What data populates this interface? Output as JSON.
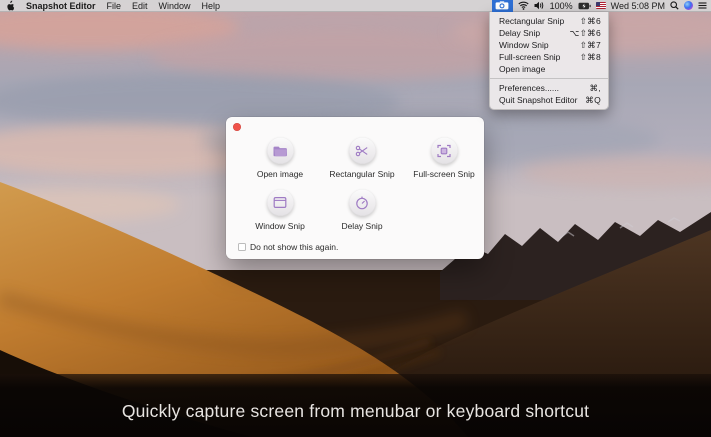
{
  "menubar": {
    "app_title": "Snapshot Editor",
    "menus": [
      {
        "label": "File"
      },
      {
        "label": "Edit"
      },
      {
        "label": "Window"
      },
      {
        "label": "Help"
      }
    ],
    "status": {
      "battery_percent": "100%",
      "clock": "Wed 5:08 PM"
    },
    "status_icons": [
      "apple-logo",
      "camera-icon",
      "wifi-icon",
      "volume-icon",
      "battery-icon",
      "us-flag-icon",
      "spotlight-search-icon",
      "siri-icon",
      "notification-center-icon"
    ]
  },
  "dropdown": {
    "primary": [
      {
        "label": "Rectangular Snip",
        "shortcut": "⇧⌘6"
      },
      {
        "label": "Delay Snip",
        "shortcut": "⌥⇧⌘6"
      },
      {
        "label": "Window Snip",
        "shortcut": "⇧⌘7"
      },
      {
        "label": "Full-screen Snip",
        "shortcut": "⇧⌘8"
      },
      {
        "label": "Open image",
        "shortcut": ""
      }
    ],
    "secondary": [
      {
        "label": "Preferences......",
        "shortcut": "⌘,"
      },
      {
        "label": "Quit Snapshot Editor",
        "shortcut": "⌘Q"
      }
    ]
  },
  "dialog": {
    "actions": [
      {
        "label": "Open image",
        "icon": "folder-icon"
      },
      {
        "label": "Rectangular Snip",
        "icon": "scissors-icon"
      },
      {
        "label": "Full-screen Snip",
        "icon": "fullscreen-icon"
      },
      {
        "label": "Window Snip",
        "icon": "window-icon"
      },
      {
        "label": "Delay Snip",
        "icon": "stopwatch-icon"
      }
    ],
    "checkbox": {
      "label": "Do not show this again.",
      "checked": false
    }
  },
  "caption": {
    "text": "Quickly capture screen from menubar or keyboard shortcut"
  },
  "colors": {
    "menubar_highlight": "#2e6fd4",
    "accent_purple": "#a07cc5",
    "close_button_red": "#f0524a",
    "caption_background": "#0a0604"
  }
}
